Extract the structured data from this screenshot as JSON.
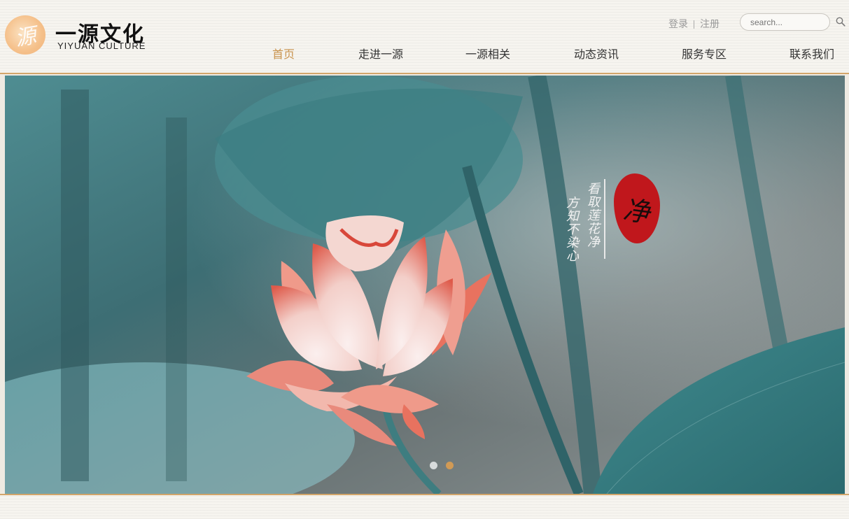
{
  "brand": {
    "seal_char": "源",
    "name_cn": "一源文化",
    "name_en": "YIYUAN CULTURE"
  },
  "top_links": {
    "login": "登录",
    "register": "注册"
  },
  "search": {
    "placeholder": "search..."
  },
  "nav": {
    "items": [
      {
        "label": "首页",
        "active": true
      },
      {
        "label": "走进一源"
      },
      {
        "label": "一源相关"
      },
      {
        "label": "动态资讯"
      },
      {
        "label": "服务专区"
      },
      {
        "label": "联系我们"
      }
    ]
  },
  "banner": {
    "poem_line1": "看取莲花净",
    "poem_line2": "方知不染心",
    "seal_char": "净",
    "slides_total": 2,
    "active_slide": 2
  },
  "colors": {
    "accent": "#c9934d",
    "border": "#d2a56a",
    "seal": "#c0171c"
  }
}
